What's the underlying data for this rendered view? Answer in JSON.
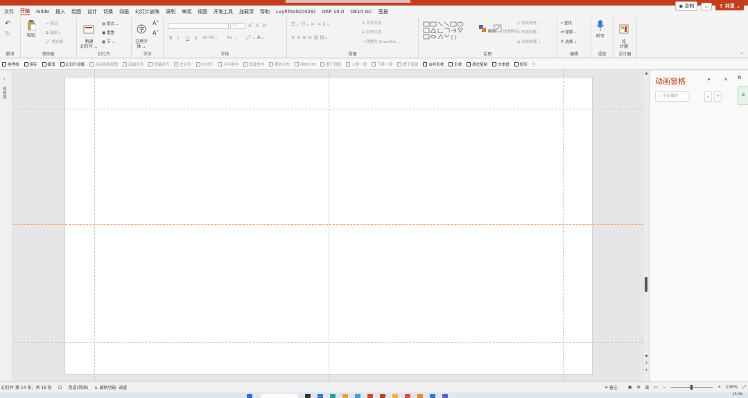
{
  "menubar": {
    "items": [
      "文件",
      "开始",
      "iSlide",
      "插入",
      "绘图",
      "设计",
      "切换",
      "动画",
      "幻灯片放映",
      "录制",
      "审阅",
      "视图",
      "开发工具",
      "加载项",
      "帮助",
      "LvyhTools(0429)",
      "OKP 10.0",
      "OK10 GC",
      "签报"
    ],
    "active_index": 1,
    "record_label": "◉ 录制",
    "share_label": "⇪ 共享 ⌄"
  },
  "ribbon": {
    "undo": {
      "label": "撤消",
      "redo": "↻"
    },
    "clipboard": {
      "label": "剪贴板",
      "paste": "粘贴",
      "cut": "剪切",
      "copy": "复制",
      "format_painter": "格式刷"
    },
    "slides": {
      "label": "幻灯片",
      "new_slide": "新建\n幻灯片 ⌄",
      "layout": "版式 ⌄",
      "reset": "重置",
      "section": "节 ⌄"
    },
    "font_char": {
      "label": "字体",
      "btn": "已用字\n体 ⌄"
    },
    "font": {
      "label": "字体",
      "size": "11",
      "bold": "B",
      "italic": "I",
      "underline": "U",
      "strike": "S",
      "aa": "Aa ⌄"
    },
    "paragraph": {
      "label": "段落",
      "text_dir": "文字方向 ⌄",
      "align_text": "对齐文本 ⌄",
      "smartart": "转换为 SmartArt ⌄"
    },
    "drawing": {
      "label": "绘图",
      "arrange": "排列",
      "quick_styles": "快速样式",
      "fill": "形状填充 ⌄",
      "outline": "形状轮廓 ⌄",
      "effects": "形状效果 ⌄"
    },
    "editing": {
      "label": "编辑",
      "find": "查找",
      "replace": "替换 ⌄",
      "select": "选择 ⌄"
    },
    "voice": {
      "label": "语音",
      "dictate": "听写"
    },
    "designer": {
      "label": "设计器",
      "btn": "设\n计器"
    }
  },
  "toolbar2": {
    "items": [
      "参考线",
      "保存",
      "撤消",
      "幻灯片母版",
      "关闭母版视图",
      "底端对齐",
      "顶端对齐",
      "左对齐",
      "右对齐",
      "水平居中",
      "垂直居中",
      "横向分布",
      "纵向分布",
      "置于顶层",
      "上移一层",
      "下移一层",
      "置于底层",
      "合并形状",
      "形状",
      "原位复制",
      "文本框",
      "矩形",
      "»"
    ]
  },
  "left_strip": {
    "label": "缩略图"
  },
  "animation_pane": {
    "title": "动画窗格",
    "play_all": "▷ 全部播放",
    "tab": "⊞"
  },
  "statusbar": {
    "slide_info": "幻灯片 第 14 张，共 18 张",
    "language": "英语(英国)",
    "accessibility": "辅助功能: 调查",
    "notes": "≙ 备注",
    "zoom": "106%"
  },
  "taskbar": {
    "time": "15:39"
  },
  "colors": {
    "accent": "#c43e1c",
    "canvas": "#e6e6e6",
    "slide": "#ffffff"
  }
}
